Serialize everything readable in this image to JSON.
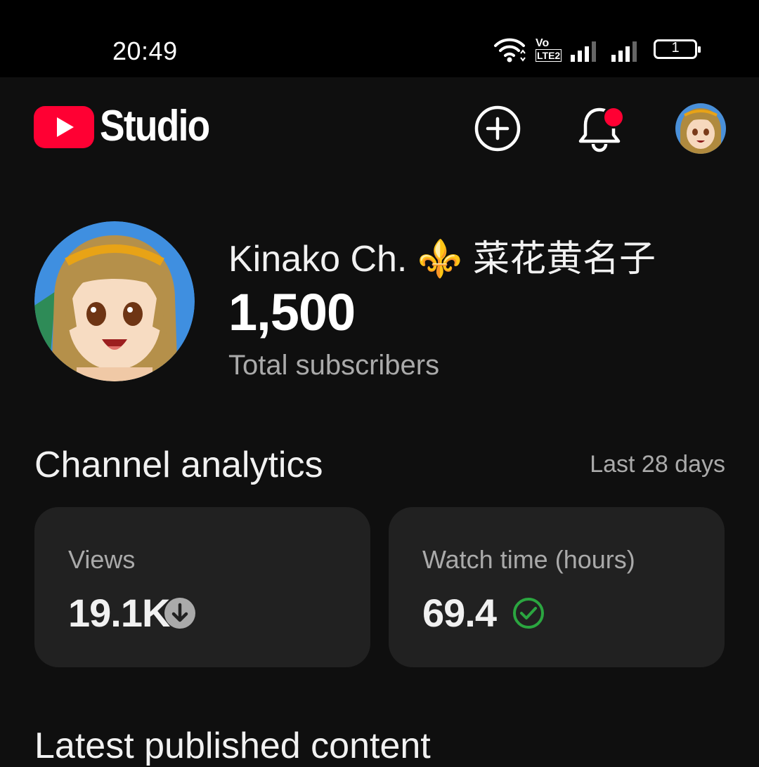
{
  "status_bar": {
    "time": "20:49",
    "icons": [
      "wifi-icon",
      "volte-icon",
      "signal-icon",
      "signal-icon",
      "battery-icon"
    ],
    "network_label": "Vo LTE2",
    "battery_level": "1"
  },
  "app_bar": {
    "logo_text": "Studio",
    "icons": [
      "youtube-logo-icon",
      "create-icon",
      "notifications-icon",
      "account-avatar"
    ],
    "notification_badge": true,
    "accent_color": "#ff0033"
  },
  "channel": {
    "name": "Kinako Ch. ⚜️ 菜花黄名子",
    "subscriber_count": "1,500",
    "subscriber_label": "Total subscribers"
  },
  "analytics": {
    "title": "Channel analytics",
    "range": "Last 28 days",
    "cards": [
      {
        "label": "Views",
        "value": "19.1K",
        "status_icon": "arrow-down-circle-icon",
        "status_color": "#aaaaaa"
      },
      {
        "label": "Watch time (hours)",
        "value": "69.4",
        "status_icon": "check-circle-icon",
        "status_color": "#2ba640"
      }
    ]
  },
  "latest": {
    "title": "Latest published content"
  }
}
